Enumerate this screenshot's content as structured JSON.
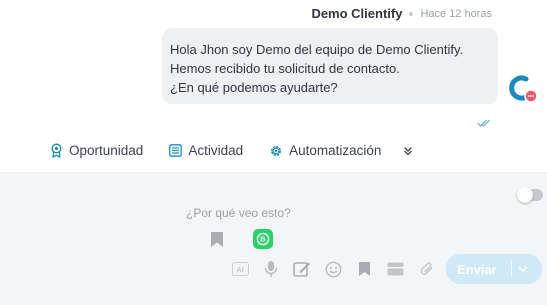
{
  "message": {
    "sender": "Demo Clientify",
    "time": "Hace 12 horas",
    "lines": [
      "Hola Jhon soy Demo del equipo de Demo Clientify.",
      "Hemos recibido tu solicitud de contacto.",
      "¿En qué podemos ayudarte?"
    ],
    "status_icon": "double-check-icon"
  },
  "tabs": [
    {
      "label": "Oportunidad",
      "icon": "award-icon"
    },
    {
      "label": "Actividad",
      "icon": "list-icon"
    },
    {
      "label": "Automatización",
      "icon": "gear-icon"
    }
  ],
  "composer": {
    "why_text": "¿Por qué veo esto?",
    "ai_label": "AI",
    "send_label": "Enviar",
    "toggle_on": false
  },
  "colors": {
    "accent": "#1a8bc1",
    "whatsapp": "#25d366",
    "send_button": "#cfe9f6",
    "bubble": "#eff0f2",
    "composer_bg": "#f4f5f7",
    "badge": "#ee5a6f"
  }
}
